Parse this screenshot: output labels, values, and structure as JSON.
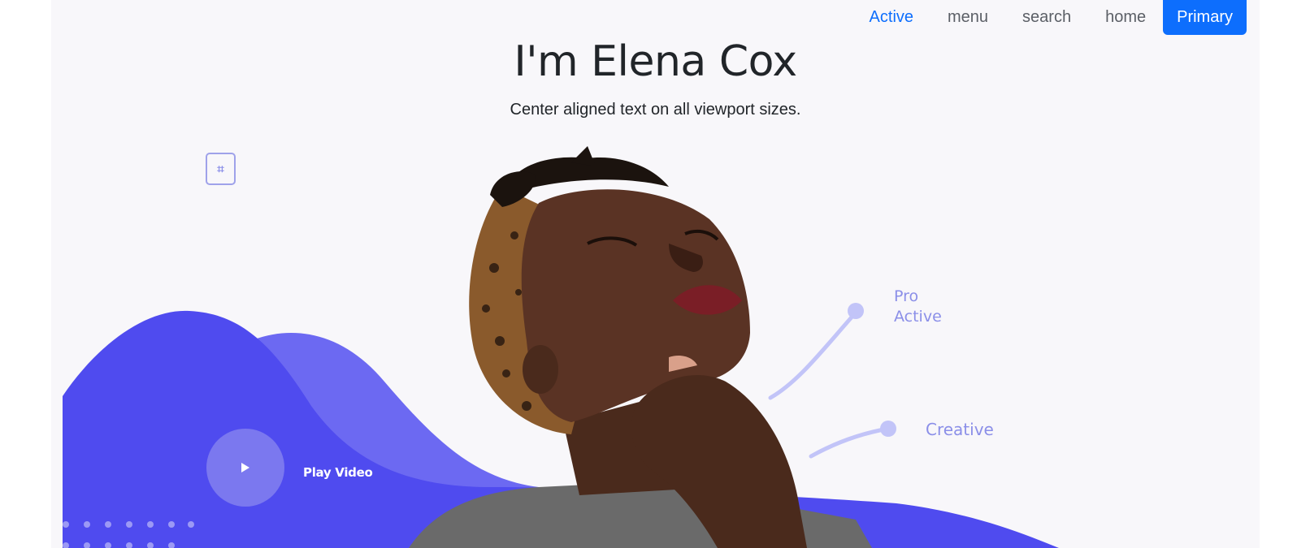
{
  "nav": {
    "items": [
      {
        "label": "Active",
        "active": true
      },
      {
        "label": "menu",
        "active": false
      },
      {
        "label": "search",
        "active": false
      },
      {
        "label": "home",
        "active": false
      }
    ],
    "primary_button": "Primary"
  },
  "hero": {
    "title": "I'm Elena Cox",
    "subtitle": "Center aligned text on all viewport sizes."
  },
  "illustration": {
    "play_label": "Play Video",
    "pro_label_line1": "Pro",
    "pro_label_line2": "Active",
    "creative_label": "Creative",
    "accent_color": "#4f4bef",
    "accent_light": "#6c69f2"
  }
}
